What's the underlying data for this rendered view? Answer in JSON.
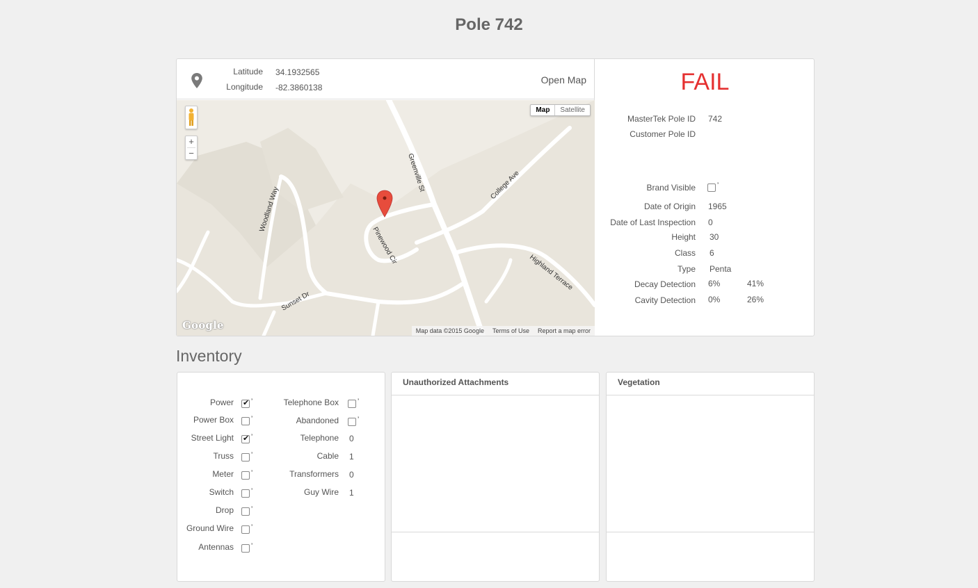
{
  "page": {
    "title": "Pole 742"
  },
  "location": {
    "latitude_label": "Latitude",
    "latitude": "34.1932565",
    "longitude_label": "Longitude",
    "longitude": "-82.3860138",
    "open_map_label": "Open Map"
  },
  "map": {
    "type_map": "Map",
    "type_satellite": "Satellite",
    "zoom_in": "+",
    "zoom_out": "−",
    "logo": "Google",
    "footer": [
      "Map data ©2015 Google",
      "Terms of Use",
      "Report a map error"
    ],
    "streets": [
      "Greenville St",
      "College Ave",
      "Woodland Way",
      "Pinewood Cir",
      "Highland Terrace",
      "Sunset Dr"
    ],
    "colors": {
      "land": "#e9e5dc",
      "park": "#e0dcd2",
      "road": "#ffffff",
      "marker": "#e74c3c"
    }
  },
  "status": {
    "result": "FAIL",
    "color": "#e53030"
  },
  "details": {
    "mastertek_id_label": "MasterTek Pole ID",
    "mastertek_id": "742",
    "customer_id_label": "Customer Pole ID",
    "customer_id": "",
    "brand_visible_label": "Brand Visible",
    "brand_visible": false,
    "date_origin_label": "Date of Origin",
    "date_origin": "1965",
    "date_inspection_label": "Date of Last Inspection",
    "date_inspection": "0",
    "height_label": "Height",
    "height": "30",
    "class_label": "Class",
    "class": "6",
    "type_label": "Type",
    "type": "Penta",
    "decay_label": "Decay Detection",
    "decay_1": "6%",
    "decay_2": "41%",
    "cavity_label": "Cavity Detection",
    "cavity_1": "0%",
    "cavity_2": "26%"
  },
  "inventory": {
    "title": "Inventory",
    "left": [
      {
        "label": "Power",
        "checked": true
      },
      {
        "label": "Power Box",
        "checked": false
      },
      {
        "label": "Street Light",
        "checked": true
      },
      {
        "label": "Truss",
        "checked": false
      },
      {
        "label": "Meter",
        "checked": false
      },
      {
        "label": "Switch",
        "checked": false
      },
      {
        "label": "Drop",
        "checked": false
      },
      {
        "label": "Ground Wire",
        "checked": false
      },
      {
        "label": "Antennas",
        "checked": false
      }
    ],
    "right": [
      {
        "label": "Telephone Box",
        "kind": "checkbox",
        "checked": false
      },
      {
        "label": "Abandoned",
        "kind": "checkbox",
        "checked": false
      },
      {
        "label": "Telephone",
        "kind": "count",
        "value": "0"
      },
      {
        "label": "Cable",
        "kind": "count",
        "value": "1"
      },
      {
        "label": "Transformers",
        "kind": "count",
        "value": "0"
      },
      {
        "label": "Guy Wire",
        "kind": "count",
        "value": "1"
      }
    ],
    "tick_mark": "ʼ"
  },
  "panels": {
    "unauthorized_title": "Unauthorized Attachments",
    "vegetation_title": "Vegetation"
  }
}
